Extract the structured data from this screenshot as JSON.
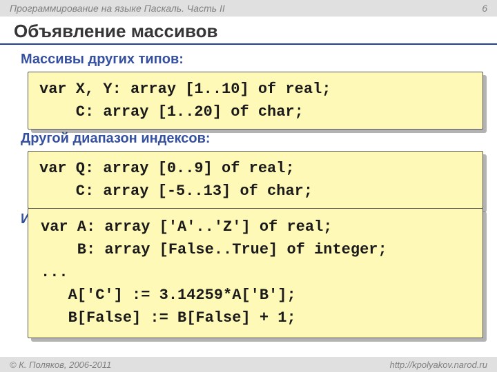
{
  "header": {
    "course": "Программирование на языке Паскаль. Часть II",
    "page_number": "6"
  },
  "slide": {
    "title": "Объявление массивов",
    "section1": "Массивы других типов:",
    "code1": "var X, Y: array [1..10] of real;\n    C: array [1..20] of char;",
    "section2": "Другой диапазон индексов:",
    "code2": "var Q: array [0..9] of real;\n    C: array [-5..13] of char;",
    "section3": "Инд",
    "code3": "var A: array ['A'..'Z'] of real;\n    B: array [False..True] of integer;\n...\n   A['C'] := 3.14259*A['B'];\n   B[False] := B[False] + 1;"
  },
  "footer": {
    "copyright": "© К. Поляков, 2006-2011",
    "url": "http://kpolyakov.narod.ru"
  }
}
